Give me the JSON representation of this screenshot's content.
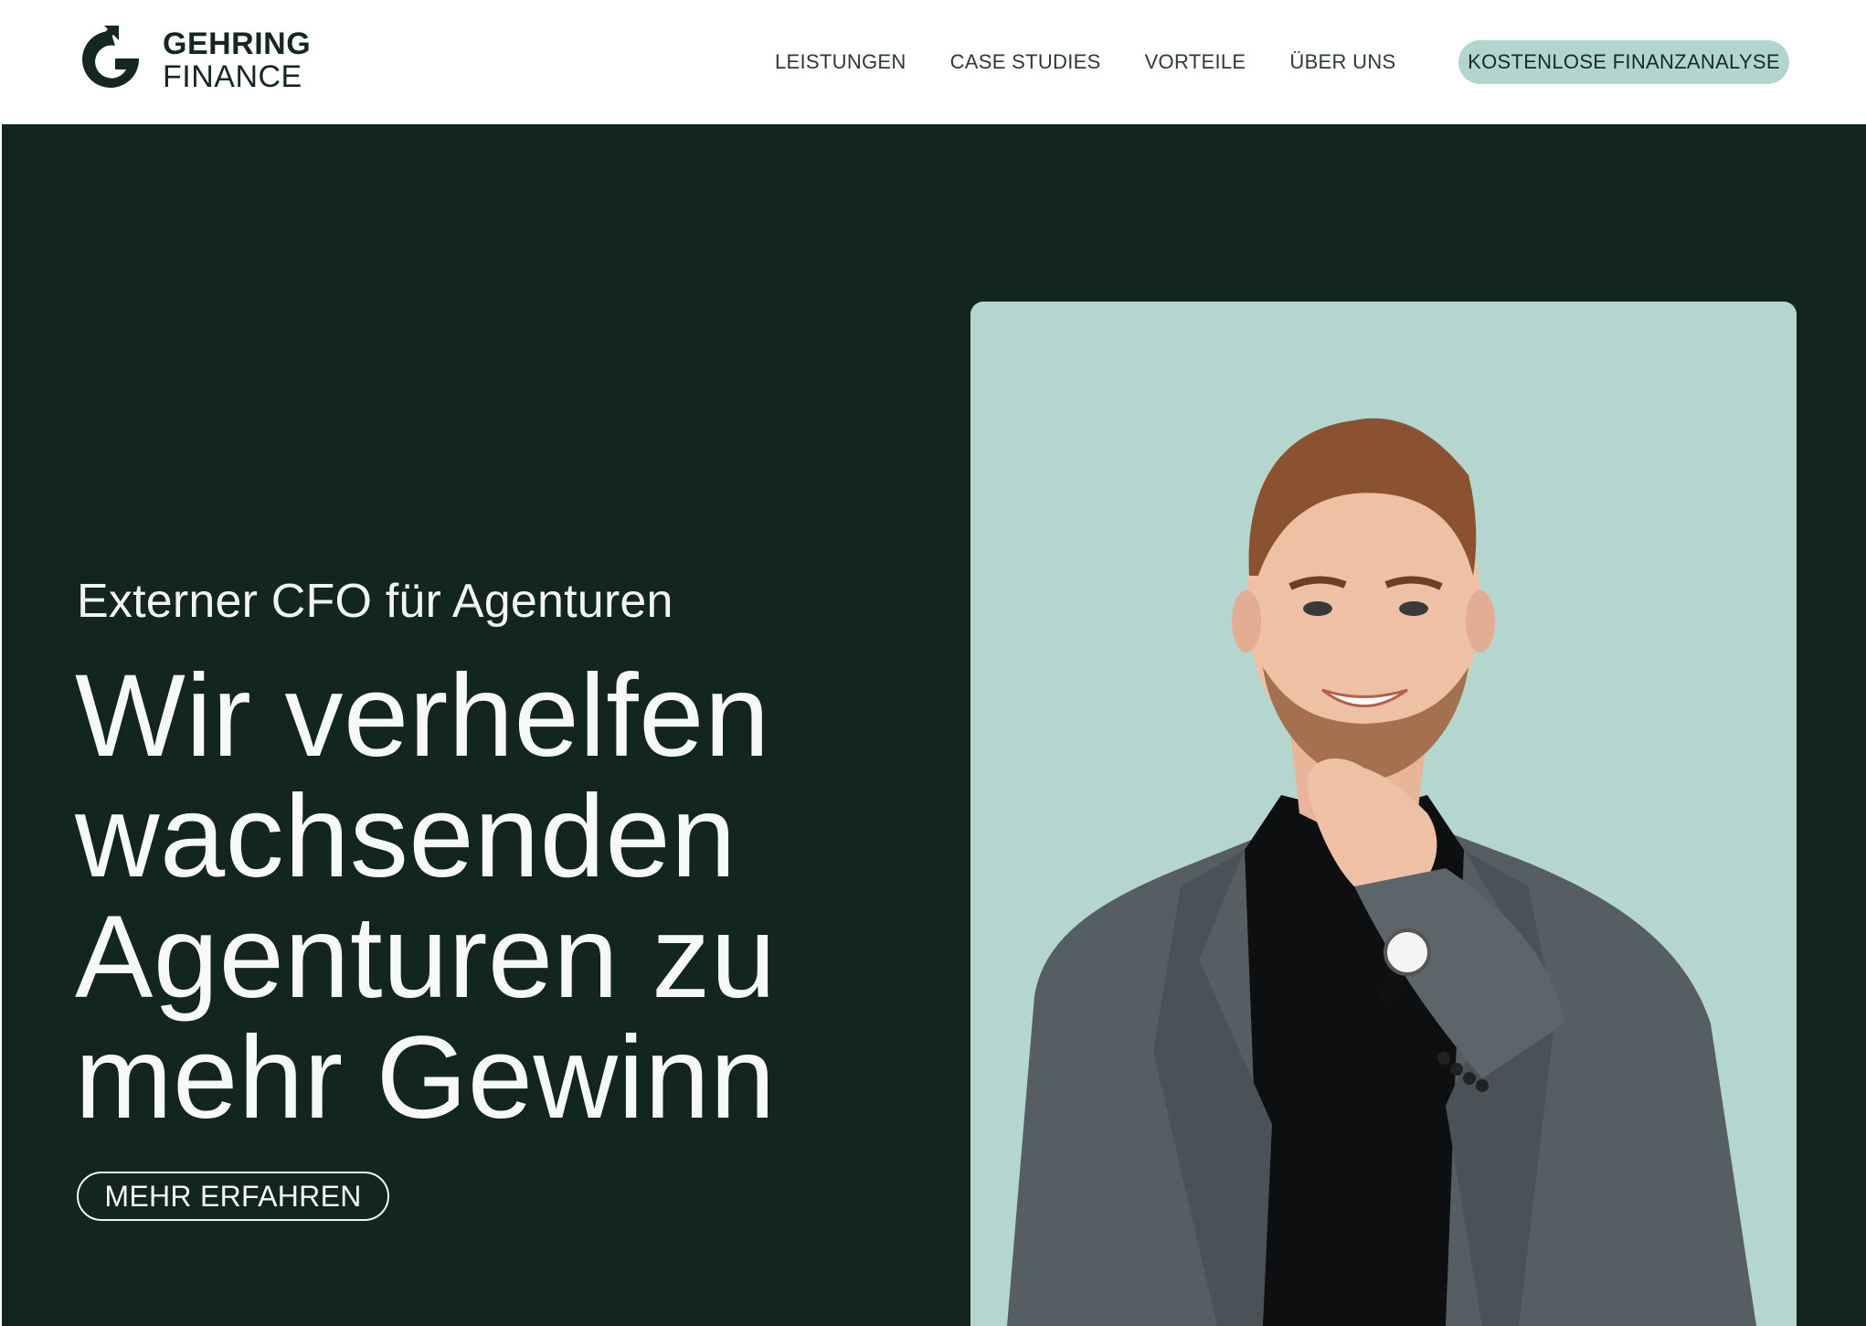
{
  "brand": {
    "name_line1": "GEHRING",
    "name_line2": "FINANCE",
    "logo_icon": "arrow-circle-g-icon"
  },
  "nav": {
    "items": [
      {
        "label": "LEISTUNGEN"
      },
      {
        "label": "CASE STUDIES"
      },
      {
        "label": "VORTEILE"
      },
      {
        "label": "ÜBER UNS"
      }
    ],
    "cta_label": "KOSTENLOSE FINANZANALYSE"
  },
  "hero": {
    "kicker": "Externer CFO für Agenturen",
    "headline_lines": [
      "Wir verhelfen",
      "wachsenden",
      "Agenturen zu",
      "mehr Gewinn"
    ],
    "button_label": "MEHR ERFAHREN"
  },
  "colors": {
    "hero_bg": "#13251f",
    "accent_mint": "#b4d6cf",
    "text_light": "#f7f8f8",
    "text_dark": "#15281f"
  }
}
